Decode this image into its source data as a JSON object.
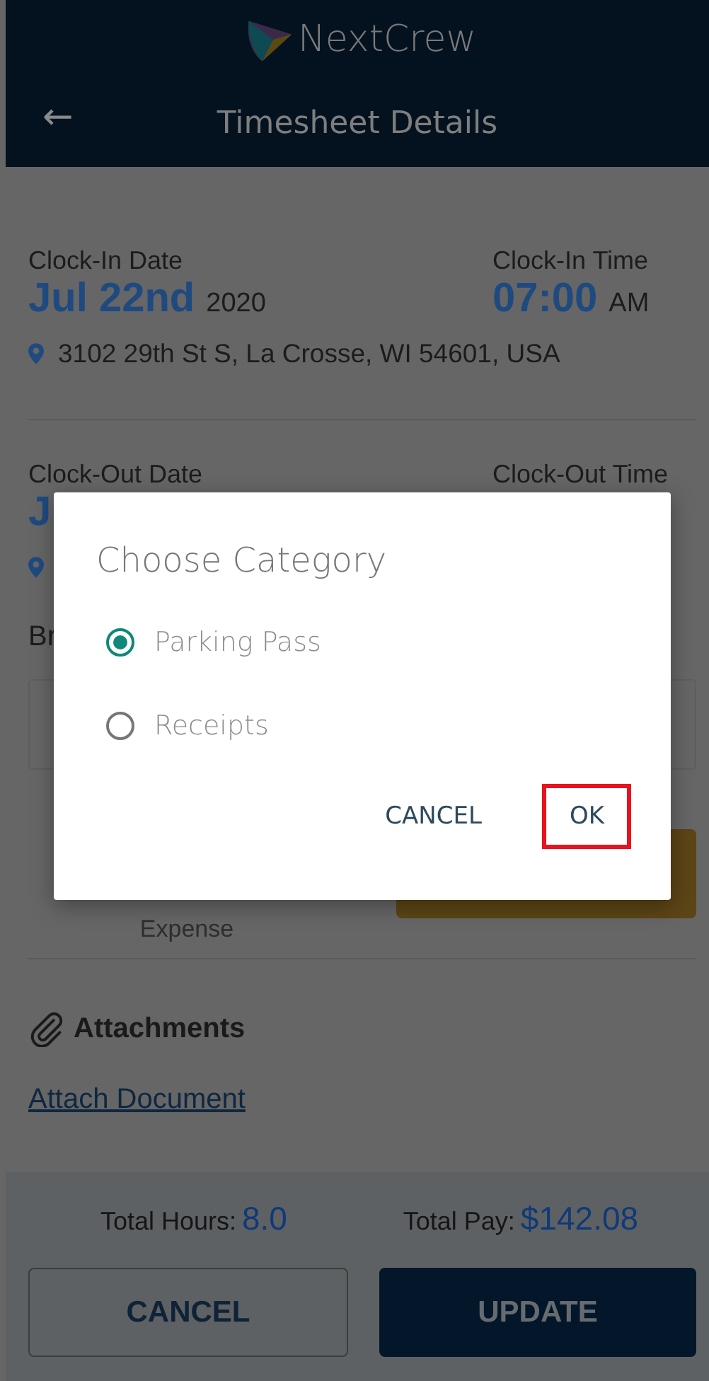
{
  "app_bar": {
    "brand": "NextCrew",
    "title": "Timesheet Details",
    "back": "←"
  },
  "clock_in": {
    "date_label": "Clock-In Date",
    "date": "Jul 22nd",
    "year": "2020",
    "time_label": "Clock-In Time",
    "time": "07:00",
    "meridiem": "AM",
    "address": "3102 29th St S, La Crosse, WI 54601, USA"
  },
  "clock_out": {
    "date_label": "Clock-Out Date",
    "time_label": "Clock-Out Time",
    "date": "J"
  },
  "break_label": "Br",
  "expense": {
    "caption": "Expense"
  },
  "attachments": {
    "title": "Attachments",
    "link": "Attach Document"
  },
  "totals": [
    {
      "label": "Total Hours:",
      "value": "8.0"
    },
    {
      "label": "Total Pay:",
      "value": "$142.08"
    }
  ],
  "footer_buttons": [
    {
      "label": "CANCEL",
      "kind": "outline"
    },
    {
      "label": "UPDATE",
      "kind": "filled"
    }
  ],
  "dialog": {
    "title": "Choose Category",
    "options": [
      {
        "label": "Parking Pass",
        "selected": true
      },
      {
        "label": "Receipts",
        "selected": false
      }
    ],
    "buttons": [
      {
        "label": "CANCEL",
        "highlighted": false
      },
      {
        "label": "OK",
        "highlighted": true
      }
    ]
  }
}
